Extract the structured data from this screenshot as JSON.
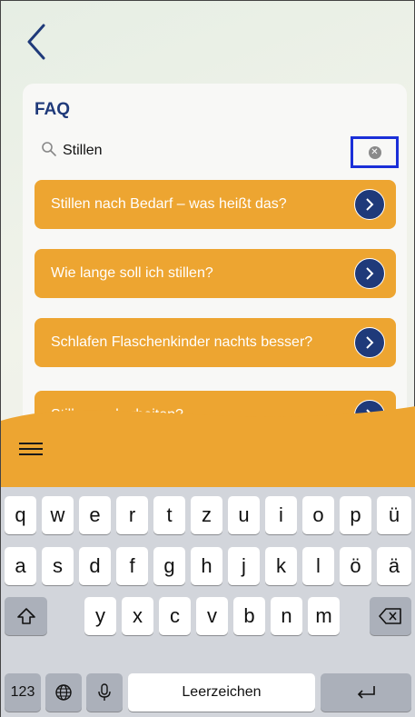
{
  "header": {
    "back_icon": "chevron-left-icon"
  },
  "faq": {
    "title": "FAQ",
    "search": {
      "value": "Stillen",
      "icon": "search-icon",
      "clear_icon": "clear-icon"
    },
    "items": [
      {
        "label": "Stillen nach Bedarf – was heißt das?"
      },
      {
        "label": "Wie lange soll ich stillen?"
      },
      {
        "label": "Schlafen Flaschenkinder nachts besser?"
      },
      {
        "label": "Stillen und arbeiten?"
      }
    ]
  },
  "bottom_bar": {
    "menu_icon": "hamburger-menu-icon",
    "color": "#eda531"
  },
  "keyboard": {
    "row1": [
      "q",
      "w",
      "e",
      "r",
      "t",
      "z",
      "u",
      "i",
      "o",
      "p",
      "ü"
    ],
    "row2": [
      "a",
      "s",
      "d",
      "f",
      "g",
      "h",
      "j",
      "k",
      "l",
      "ö",
      "ä"
    ],
    "row3": [
      "y",
      "x",
      "c",
      "v",
      "b",
      "n",
      "m"
    ],
    "numbers_label": "123",
    "space_label": "Leerzeichen",
    "shift_icon": "shift-icon",
    "backspace_icon": "backspace-icon",
    "globe_icon": "globe-icon",
    "mic_icon": "microphone-icon",
    "return_icon": "return-icon"
  },
  "colors": {
    "accent": "#eda531",
    "navy": "#1f3a7a",
    "highlight": "#1a2fd8"
  }
}
